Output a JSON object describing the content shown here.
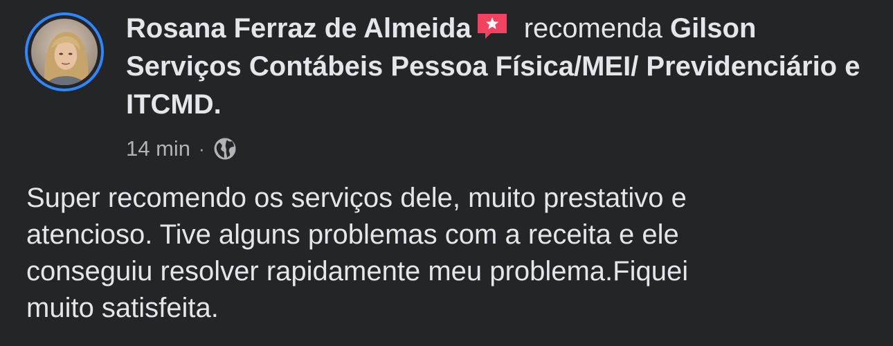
{
  "post": {
    "author": "Rosana Ferraz de Almeida",
    "verb": "recomenda",
    "page_name": "Gilson Serviços Contábeis Pessoa Física/MEI/ Previdenciário e ITCMD.",
    "timestamp": "14 min",
    "separator": "·",
    "privacy_icon": "globe-icon",
    "recommend_badge_icon": "star-speech-bubble-icon",
    "body": "Super recomendo os serviços dele, muito prestativo e\natencioso. Tive alguns problemas com a receita e ele\nconseguiu resolver rapidamente meu problema.Fiquei\nmuito satisfeita."
  },
  "colors": {
    "background": "#242526",
    "text_primary": "#e4e6eb",
    "text_secondary": "#b0b3b8",
    "avatar_ring": "#2d88ff",
    "badge": "#f3425f"
  }
}
